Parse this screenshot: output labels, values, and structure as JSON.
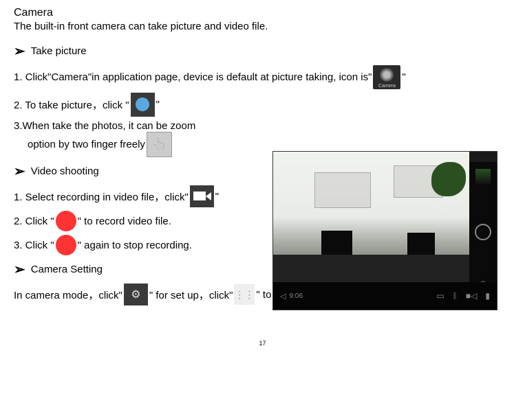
{
  "title": "Camera",
  "intro": "The built-in front camera can take picture and video file.",
  "section1": {
    "heading": "Take picture",
    "step1_a": "1. Click\"Camera\"in application page, device is default at picture taking, icon is\"",
    "step1_b": "\"",
    "step2_a": "2. To take picture，click  \"",
    "step2_b": "\"",
    "step3_a": "3.When take the photos,  it can be zoom",
    "step3_b": "option by two finger freely"
  },
  "section2": {
    "heading": "Video shooting",
    "step1_a": "1. Select recording in video file，click\"",
    "step1_b": "\"",
    "step2_a": "2. Click  \"",
    "step2_b": "\" to record video file.",
    "step3_a": "3. Click  \"",
    "step3_b": "\" again to stop recording."
  },
  "section3": {
    "heading": "Camera Setting",
    "line_a": "In camera mode，click\"",
    "line_b": "\"   for set up，click\"",
    "line_c": "\" to select set up options."
  },
  "screenshot": {
    "time": "9:06",
    "camera_label": "Camera"
  },
  "page": "17"
}
